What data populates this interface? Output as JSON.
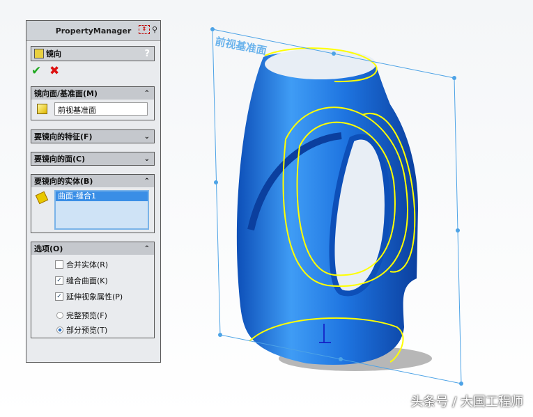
{
  "panel": {
    "title": "PropertyManager",
    "feature": "镜向",
    "help": "?",
    "sections": {
      "mirror_face": {
        "label": "镜向面/基准面(M)",
        "value": "前视基准面"
      },
      "features": {
        "label": "要镜向的特征(F)"
      },
      "faces": {
        "label": "要镜向的面(C)"
      },
      "bodies": {
        "label": "要镜向的实体(B)",
        "items": [
          "曲面-缝合1"
        ]
      },
      "options": {
        "label": "选项(O)",
        "merge": {
          "label": "合并实体(R)",
          "checked": false
        },
        "knit": {
          "label": "缝合曲面(K)",
          "checked": true
        },
        "propagate": {
          "label": "延伸视象属性(P)",
          "checked": true
        },
        "full_preview": {
          "label": "完整预览(F)",
          "selected": false
        },
        "partial_preview": {
          "label": "部分预览(T)",
          "selected": true
        }
      }
    }
  },
  "viewport": {
    "plane_label": "前视基准面",
    "colors": {
      "body": "#1a6fe0",
      "sketch": "#ffff00",
      "plane": "#4da3e6"
    }
  },
  "watermark": "头条号 / 大国工程师"
}
